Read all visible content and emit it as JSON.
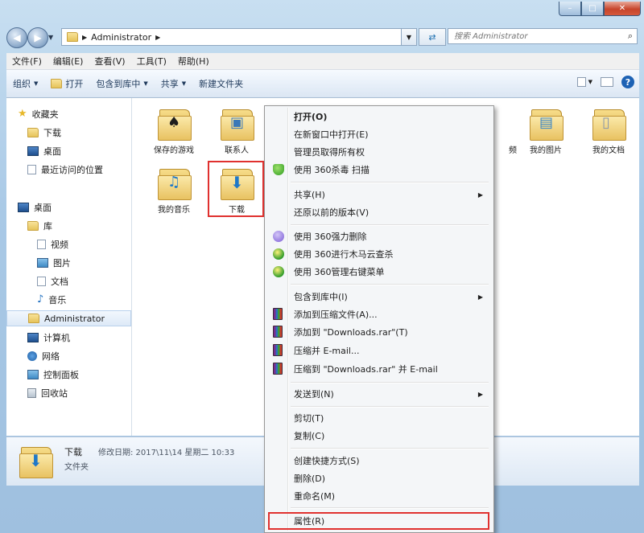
{
  "window": {
    "controls": {
      "minimize": "–",
      "maximize": "□",
      "close": "✕"
    }
  },
  "address": {
    "path": [
      "Administrator"
    ],
    "search_placeholder": "搜索 Administrator"
  },
  "menubar": [
    "文件(F)",
    "编辑(E)",
    "查看(V)",
    "工具(T)",
    "帮助(H)"
  ],
  "toolbar": {
    "organize": "组织",
    "open": "打开",
    "include_library": "包含到库中",
    "share": "共享",
    "new_folder": "新建文件夹"
  },
  "nav": {
    "favorites": "收藏夹",
    "fav_items": [
      "下载",
      "桌面",
      "最近访问的位置"
    ],
    "desktop": "桌面",
    "library": "库",
    "lib_items": [
      "视频",
      "图片",
      "文档",
      "音乐"
    ],
    "administrator": "Administrator",
    "computer": "计算机",
    "network": "网络",
    "control_panel": "控制面板",
    "recycle": "回收站"
  },
  "folders": {
    "saved_games": "保存的游戏",
    "contacts": "联系人",
    "partial_hidden": "频",
    "my_pictures": "我的图片",
    "my_documents": "我的文档",
    "my_music": "我的音乐",
    "downloads": "下载"
  },
  "details": {
    "name": "下载",
    "modified": "修改日期: 2017\\11\\14 星期二 10:33",
    "type": "文件夹"
  },
  "context_menu": {
    "open": "打开(O)",
    "open_new_window": "在新窗口中打开(E)",
    "take_ownership": "管理员取得所有权",
    "scan_360": "使用 360杀毒 扫描",
    "share": "共享(H)",
    "restore": "还原以前的版本(V)",
    "force_delete": "使用 360强力删除",
    "cloud_scan": "使用 360进行木马云查杀",
    "manage_menu": "使用 360管理右键菜单",
    "include_library": "包含到库中(I)",
    "add_archive": "添加到压缩文件(A)...",
    "add_rar": "添加到 \"Downloads.rar\"(T)",
    "compress_email": "压缩并 E-mail...",
    "compress_rar_email": "压缩到 \"Downloads.rar\" 并 E-mail",
    "send_to": "发送到(N)",
    "cut": "剪切(T)",
    "copy": "复制(C)",
    "create_shortcut": "创建快捷方式(S)",
    "delete": "删除(D)",
    "rename": "重命名(M)",
    "properties": "属性(R)"
  },
  "colors": {
    "highlight": "#e0312f",
    "frame": "#a9c9e6"
  }
}
